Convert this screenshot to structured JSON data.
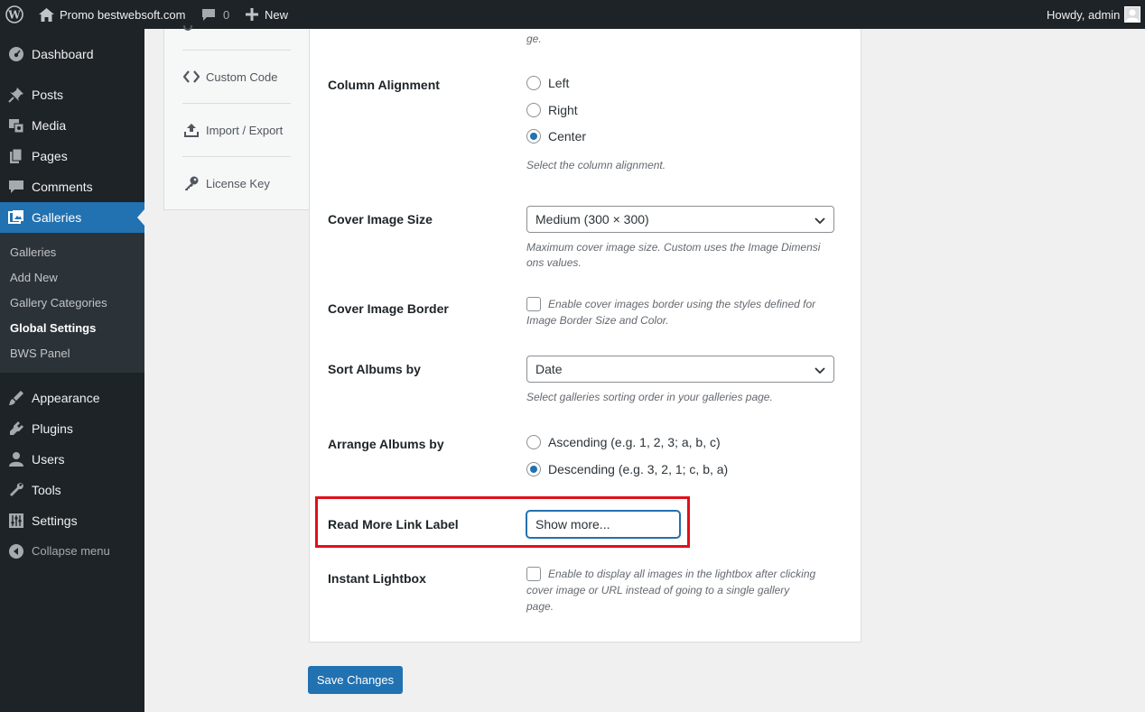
{
  "admin_bar": {
    "site_name": "Promo bestwebsoft.com",
    "comments_count": "0",
    "new_label": "New",
    "greeting": "Howdy, admin"
  },
  "sidebar": {
    "items": [
      {
        "label": "Dashboard",
        "icon": "dashboard-icon"
      },
      {
        "label": "Posts",
        "icon": "pin-icon"
      },
      {
        "label": "Media",
        "icon": "media-icon"
      },
      {
        "label": "Pages",
        "icon": "pages-icon"
      },
      {
        "label": "Comments",
        "icon": "comment-icon"
      },
      {
        "label": "Galleries",
        "icon": "gallery-icon"
      },
      {
        "label": "Appearance",
        "icon": "brush-icon"
      },
      {
        "label": "Plugins",
        "icon": "plug-icon"
      },
      {
        "label": "Users",
        "icon": "user-icon"
      },
      {
        "label": "Tools",
        "icon": "wrench-icon"
      },
      {
        "label": "Settings",
        "icon": "sliders-icon"
      }
    ],
    "submenu": [
      "Galleries",
      "Add New",
      "Gallery Categories",
      "Global Settings",
      "BWS Panel"
    ],
    "collapse_label": "Collapse menu"
  },
  "tabs": {
    "partial_top": "ge.",
    "items": [
      "Custom Code",
      "Import / Export",
      "License Key"
    ]
  },
  "settings": {
    "column_alignment": {
      "label": "Column Alignment",
      "options": [
        "Left",
        "Right",
        "Center"
      ],
      "selected": "Center",
      "description": "Select the column alignment."
    },
    "cover_image_size": {
      "label": "Cover Image Size",
      "value": "Medium (300 × 300)",
      "description_line1": "Maximum cover image size. Custom uses the Image Dimensi",
      "description_line2": "ons values."
    },
    "cover_image_border": {
      "label": "Cover Image Border",
      "checked": false,
      "description_line1": "Enable cover images border using the styles defined for",
      "description_line2": "Image Border Size and Color."
    },
    "sort_albums_by": {
      "label": "Sort Albums by",
      "value": "Date",
      "description": "Select galleries sorting order in your galleries page."
    },
    "arrange_albums_by": {
      "label": "Arrange Albums by",
      "options": [
        "Ascending (e.g. 1, 2, 3; a, b, c)",
        "Descending (e.g. 3, 2, 1; c, b, a)"
      ],
      "selected": "Descending (e.g. 3, 2, 1; c, b, a)"
    },
    "read_more_link_label": {
      "label": "Read More Link Label",
      "value": "Show more..."
    },
    "instant_lightbox": {
      "label": "Instant Lightbox",
      "checked": false,
      "description_line1": "Enable to display all images in the lightbox after clicking",
      "description_line2": "cover image or URL instead of going to a single gallery",
      "description_line3": "page."
    }
  },
  "save_button": "Save Changes",
  "colors": {
    "accent": "#2271b1",
    "sidebar_bg": "#1d2327",
    "highlight": "#e0101a"
  }
}
